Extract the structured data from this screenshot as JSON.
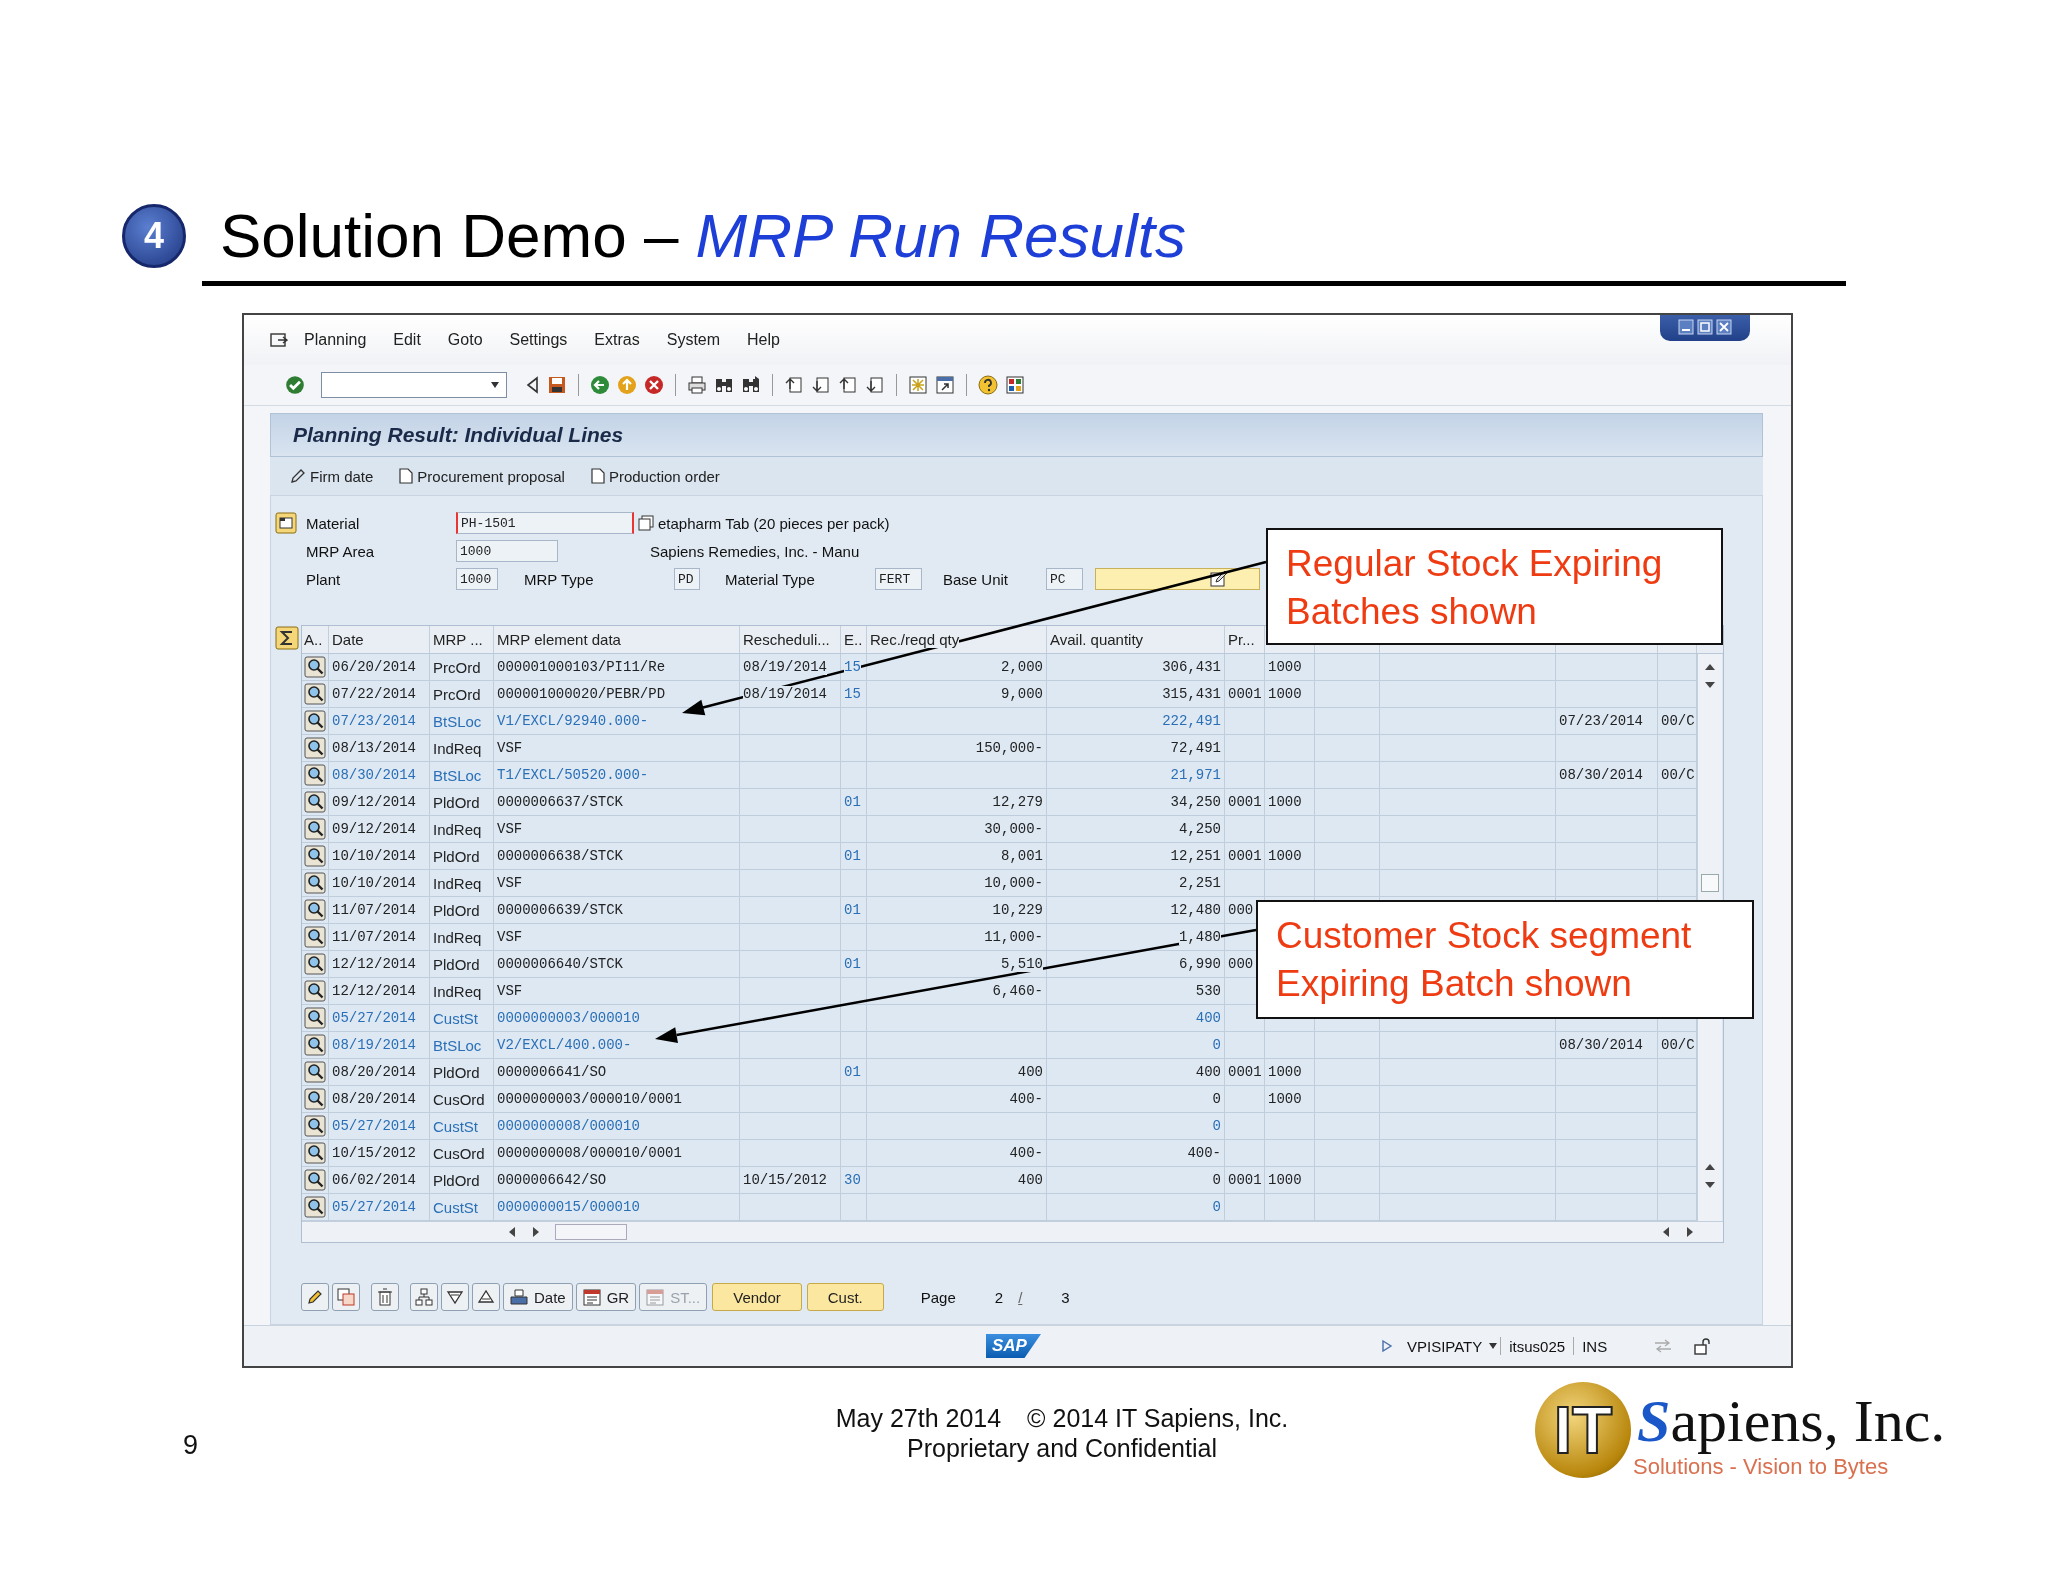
{
  "slide": {
    "step": "4",
    "title": "Solution Demo – *MRP Run Results*"
  },
  "sap_window": {
    "menu": [
      "Planning",
      "Edit",
      "Goto",
      "Settings",
      "Extras",
      "System",
      "Help"
    ],
    "screen_title": "Planning Result: Individual Lines",
    "actions": [
      "Firm date",
      "Procurement proposal",
      "Production order"
    ],
    "header": {
      "material": {
        "label": "Material",
        "value": "PH-1501",
        "focused": true,
        "description": "etapharm Tab (20 pieces per pack)"
      },
      "mrp_area": {
        "label": "MRP Area",
        "value": "1000",
        "description": "Sapiens Remedies, Inc. - Manu"
      },
      "plant": {
        "label": "Plant",
        "value": "1000"
      },
      "mrp_type": {
        "label": "MRP Type",
        "value": "PD"
      },
      "material_type": {
        "label": "Material Type",
        "value": "FERT"
      },
      "base_unit": {
        "label": "Base Unit",
        "value": "PC"
      }
    },
    "table": {
      "columns": [
        "A..",
        "Date",
        "MRP ...",
        "MRP element data",
        "Rescheduli...",
        "E..",
        "Rec./reqd qty",
        "Avail. quantity",
        "Pr..."
      ],
      "rows": [
        {
          "date": "06/20/2014",
          "mrp": "PrcOrd",
          "element": "000001000103/PI11/Re",
          "rescheduling": "08/19/2014",
          "exception": "15",
          "rec_reqd_qty": "2,000",
          "avail_qty": "306,431",
          "column_10": "1000",
          "highlighted": false
        },
        {
          "date": "07/22/2014",
          "mrp": "PrcOrd",
          "element": "000001000020/PEBR/PD",
          "rescheduling": "08/19/2014",
          "exception": "15",
          "rec_reqd_qty": "9,000",
          "avail_qty": "315,431",
          "pr": "0001",
          "column_10": "1000",
          "highlighted": false
        },
        {
          "date": "07/23/2014",
          "mrp": "BtSLoc",
          "element": "V1/EXCL/92940.000-",
          "avail_qty": "222,491",
          "column_13": "07/23/2014",
          "column_14": "00/C",
          "highlighted": true
        },
        {
          "date": "08/13/2014",
          "mrp": "IndReq",
          "element": "VSF",
          "rec_reqd_qty": "150,000-",
          "avail_qty": "72,491",
          "highlighted": false
        },
        {
          "date": "08/30/2014",
          "mrp": "BtSLoc",
          "element": "T1/EXCL/50520.000-",
          "avail_qty": "21,971",
          "column_13": "08/30/2014",
          "column_14": "00/C",
          "highlighted": true
        },
        {
          "date": "09/12/2014",
          "mrp": "PldOrd",
          "element": "0000006637/STCK",
          "exception": "01",
          "rec_reqd_qty": "12,279",
          "avail_qty": "34,250",
          "pr": "0001",
          "column_10": "1000",
          "highlighted": false
        },
        {
          "date": "09/12/2014",
          "mrp": "IndReq",
          "element": "VSF",
          "rec_reqd_qty": "30,000-",
          "avail_qty": "4,250",
          "highlighted": false
        },
        {
          "date": "10/10/2014",
          "mrp": "PldOrd",
          "element": "0000006638/STCK",
          "exception": "01",
          "rec_reqd_qty": "8,001",
          "avail_qty": "12,251",
          "pr": "0001",
          "column_10": "1000",
          "highlighted": false
        },
        {
          "date": "10/10/2014",
          "mrp": "IndReq",
          "element": "VSF",
          "rec_reqd_qty": "10,000-",
          "avail_qty": "2,251",
          "highlighted": false
        },
        {
          "date": "11/07/2014",
          "mrp": "PldOrd",
          "element": "0000006639/STCK",
          "exception": "01",
          "rec_reqd_qty": "10,229",
          "avail_qty": "12,480",
          "pr": "000",
          "highlighted": false
        },
        {
          "date": "11/07/2014",
          "mrp": "IndReq",
          "element": "VSF",
          "rec_reqd_qty": "11,000-",
          "avail_qty": "1,480",
          "highlighted": false
        },
        {
          "date": "12/12/2014",
          "mrp": "PldOrd",
          "element": "0000006640/STCK",
          "exception": "01",
          "rec_reqd_qty": "5,510",
          "avail_qty": "6,990",
          "pr": "000",
          "highlighted": false
        },
        {
          "date": "12/12/2014",
          "mrp": "IndReq",
          "element": "VSF",
          "rec_reqd_qty": "6,460-",
          "avail_qty": "530",
          "highlighted": false
        },
        {
          "date": "05/27/2014",
          "mrp": "CustSt",
          "element": "0000000003/000010",
          "avail_qty": "400",
          "highlighted": true
        },
        {
          "date": "08/19/2014",
          "mrp": "BtSLoc",
          "element": "V2/EXCL/400.000-",
          "avail_qty": "0",
          "column_13": "08/30/2014",
          "column_14": "00/C",
          "highlighted": true
        },
        {
          "date": "08/20/2014",
          "mrp": "PldOrd",
          "element": "0000006641/SO",
          "exception": "01",
          "rec_reqd_qty": "400",
          "avail_qty": "400",
          "pr": "0001",
          "column_10": "1000",
          "highlighted": false
        },
        {
          "date": "08/20/2014",
          "mrp": "CusOrd",
          "element": "0000000003/000010/0001",
          "rec_reqd_qty": "400-",
          "avail_qty": "0",
          "column_10": "1000",
          "highlighted": false
        },
        {
          "date": "05/27/2014",
          "mrp": "CustSt",
          "element": "0000000008/000010",
          "avail_qty": "0",
          "highlighted": true
        },
        {
          "date": "10/15/2012",
          "mrp": "CusOrd",
          "element": "0000000008/000010/0001",
          "rec_reqd_qty": "400-",
          "avail_qty": "400-",
          "highlighted": false
        },
        {
          "date": "06/02/2014",
          "mrp": "PldOrd",
          "element": "0000006642/SO",
          "rescheduling": "10/15/2012",
          "exception": "30",
          "rec_reqd_qty": "400",
          "avail_qty": "0",
          "pr": "0001",
          "column_10": "1000",
          "highlighted": false
        },
        {
          "date": "05/27/2014",
          "mrp": "CustSt",
          "element": "0000000015/000010",
          "avail_qty": "0",
          "highlighted": true
        }
      ]
    },
    "buttons": [
      {
        "kind": "icon",
        "label": "Date",
        "disabled": false
      },
      {
        "kind": "icon",
        "label": "GR",
        "disabled": false
      },
      {
        "kind": "icon",
        "label": "ST...",
        "disabled": true
      },
      {
        "kind": "plain",
        "label": "Vendor",
        "disabled": false
      },
      {
        "kind": "plain",
        "label": "Cust.",
        "disabled": false
      }
    ],
    "pager": {
      "label": "Page",
      "current": "2",
      "separator": "/",
      "total": "3"
    },
    "status_bar": {
      "logo": "SAP",
      "system": "VPISIPATY",
      "server": "itsus025",
      "mode": "INS"
    }
  },
  "callouts": [
    {
      "text": "Regular Stock Expiring Batches shown"
    },
    {
      "text": "Customer Stock segment Expiring Batch shown"
    }
  ],
  "footer": {
    "page_number": "9",
    "date": "May 27th 2014",
    "copyright": "© 2014 IT Sapiens, Inc.",
    "notice": "Proprietary and Confidential"
  },
  "logo": {
    "mark": "IT",
    "name": "Sapiens, Inc.",
    "tagline": "Solutions - Vision to Bytes"
  }
}
